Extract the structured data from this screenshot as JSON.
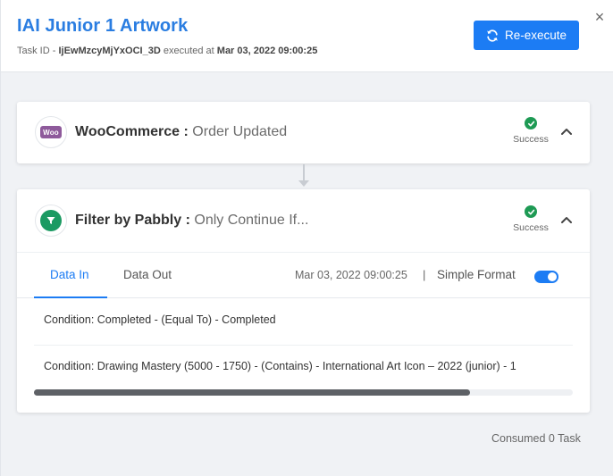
{
  "header": {
    "title": "IAI Junior 1 Artwork",
    "task_id_label": "Task ID - ",
    "task_id": "IjEwMzcyMjYxOCI_3D",
    "executed_label": " executed at ",
    "executed_at": "Mar 03, 2022 09:00:25",
    "close_symbol": "×",
    "reexecute_label": "Re-execute"
  },
  "steps": [
    {
      "logo_text": "Woo",
      "app": "WooCommerce :",
      "event": "Order Updated",
      "status": "Success"
    },
    {
      "app": "Filter by Pabbly :",
      "event": "Only Continue If...",
      "status": "Success",
      "tabs": [
        "Data In",
        "Data Out"
      ],
      "timestamp": "Mar 03, 2022 09:00:25",
      "separator": "|",
      "format_label": "Simple Format",
      "conditions": [
        "Condition: Completed - (Equal To) - Completed",
        "Condition: Drawing Mastery (5000 - 1750) - (Contains) - International Art Icon – 2022 (junior) - 1"
      ]
    }
  ],
  "footer": {
    "consumed": "Consumed 0 Task"
  },
  "colors": {
    "accent": "#1c7cf4",
    "success": "#1e9a54",
    "woo": "#8e5a9b",
    "filter": "#1b9a62"
  }
}
